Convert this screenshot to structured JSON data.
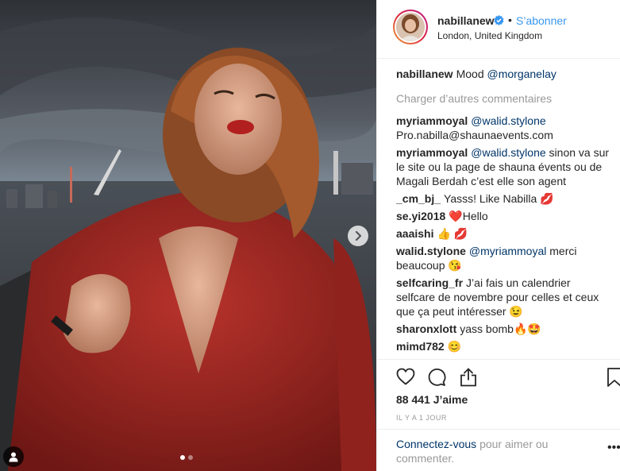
{
  "post": {
    "username": "nabillanew",
    "follow_label": "S’abonner",
    "separator": "•",
    "location": "London, United Kingdom"
  },
  "caption": {
    "username": "nabillanew",
    "text": "Mood",
    "mention": "@morganelay"
  },
  "load_more": "Charger d’autres commentaires",
  "comments": [
    {
      "user": "myriammoyal",
      "mention": "@walid.stylone",
      "text": "Pro.nabilla@shaunaevents.com",
      "emoji": ""
    },
    {
      "user": "myriammoyal",
      "mention": "@walid.stylone",
      "text": "sinon va sur le site ou la page de shauna évents ou de Magali Berdah c’est elle son agent",
      "emoji": ""
    },
    {
      "user": "_cm_bj_",
      "mention": "",
      "text": "Yasss! Like Nabilla",
      "emoji": "💋"
    },
    {
      "user": "se.yi2018",
      "mention": "",
      "text": "Hello",
      "emoji": "❤️"
    },
    {
      "user": "aaaishi",
      "mention": "",
      "text": "",
      "emoji": "👍 💋"
    },
    {
      "user": "walid.stylone",
      "mention": "@myriammoyal",
      "text": "merci beaucoup",
      "emoji": "😘"
    },
    {
      "user": "selfcaring_fr",
      "mention": "",
      "text": "J’ai fais un calendrier selfcare de novembre pour celles et ceux que ça peut intéresser",
      "emoji": "😉"
    },
    {
      "user": "sharonxlott",
      "mention": "",
      "text": "yass bomb",
      "emoji": "🔥🤩"
    },
    {
      "user": "mimd782",
      "mention": "",
      "text": "",
      "emoji": "😊"
    }
  ],
  "likes": "88 441 J’aime",
  "time": "IL Y A 1 JOUR",
  "login": {
    "link": "Connectez-vous",
    "text": "pour aimer ou commenter."
  },
  "more_options": "•••",
  "carousel": {
    "current": 1,
    "total": 2
  },
  "icons": {
    "like": "heart-icon",
    "comment": "comment-icon",
    "share": "share-icon",
    "save": "bookmark-icon",
    "verified": "verified-badge-icon",
    "next": "chevron-right-icon",
    "tags": "user-tag-icon"
  },
  "colors": {
    "link": "#3897f0",
    "mention": "#003569",
    "muted": "#999999",
    "verified": "#3897f0"
  }
}
